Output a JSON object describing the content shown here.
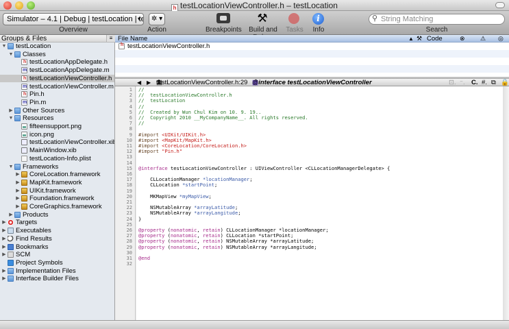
{
  "window": {
    "title": "testLocationViewController.h – testLocation"
  },
  "toolbar": {
    "overview_value": "Simulator – 4.1 | Debug | testLocation | tes…",
    "overview_label": "Overview",
    "action_label": "Action",
    "breakpoints_label": "Breakpoints",
    "build_debug_label": "Build and Debug",
    "tasks_label": "Tasks",
    "info_label": "Info",
    "search_placeholder": "String Matching",
    "search_label": "Search",
    "action_glyph": "✲ ▾",
    "info_glyph": "i",
    "hammer_glyph": "⚒"
  },
  "groups_header": "Groups & Files",
  "tree": [
    {
      "label": "testLocation",
      "icon": "project",
      "depth": 0,
      "expanded": true
    },
    {
      "label": "Classes",
      "icon": "folder",
      "depth": 1,
      "expanded": true
    },
    {
      "label": "testLocationAppDelegate.h",
      "icon": "h",
      "depth": 2
    },
    {
      "label": "testLocationAppDelegate.m",
      "icon": "m",
      "depth": 2
    },
    {
      "label": "testLocationViewController.h",
      "icon": "h",
      "depth": 2,
      "selected": true
    },
    {
      "label": "testLocationViewController.m",
      "icon": "m",
      "depth": 2
    },
    {
      "label": "Pin.h",
      "icon": "h",
      "depth": 2
    },
    {
      "label": "Pin.m",
      "icon": "m",
      "depth": 2
    },
    {
      "label": "Other Sources",
      "icon": "folder",
      "depth": 1,
      "expanded": false
    },
    {
      "label": "Resources",
      "icon": "folder",
      "depth": 1,
      "expanded": true
    },
    {
      "label": "fifteensupport.png",
      "icon": "img",
      "depth": 2
    },
    {
      "label": "icon.png",
      "icon": "img",
      "depth": 2
    },
    {
      "label": "testLocationViewController.xib",
      "icon": "xib",
      "depth": 2
    },
    {
      "label": "MainWindow.xib",
      "icon": "xib",
      "depth": 2
    },
    {
      "label": "testLocation-Info.plist",
      "icon": "plist",
      "depth": 2
    },
    {
      "label": "Frameworks",
      "icon": "folder",
      "depth": 1,
      "expanded": true
    },
    {
      "label": "CoreLocation.framework",
      "icon": "fw",
      "depth": 2,
      "expanded": false
    },
    {
      "label": "MapKit.framework",
      "icon": "fw",
      "depth": 2,
      "expanded": false
    },
    {
      "label": "UIKit.framework",
      "icon": "fw",
      "depth": 2,
      "expanded": false
    },
    {
      "label": "Foundation.framework",
      "icon": "fw",
      "depth": 2,
      "expanded": false
    },
    {
      "label": "CoreGraphics.framework",
      "icon": "fw",
      "depth": 2,
      "expanded": false
    },
    {
      "label": "Products",
      "icon": "folder",
      "depth": 1,
      "expanded": false
    },
    {
      "label": "Targets",
      "icon": "target",
      "depth": 0,
      "expanded": false
    },
    {
      "label": "Executables",
      "icon": "exe",
      "depth": 0,
      "expanded": false
    },
    {
      "label": "Find Results",
      "icon": "find",
      "depth": 0,
      "expanded": false
    },
    {
      "label": "Bookmarks",
      "icon": "bm",
      "depth": 0,
      "expanded": false
    },
    {
      "label": "SCM",
      "icon": "scm",
      "depth": 0,
      "expanded": false
    },
    {
      "label": "Project Symbols",
      "icon": "sym",
      "depth": 0
    },
    {
      "label": "Implementation Files",
      "icon": "folder",
      "depth": 0,
      "expanded": false
    },
    {
      "label": "Interface Builder Files",
      "icon": "folder",
      "depth": 0,
      "expanded": false
    }
  ],
  "file_list": {
    "columns": [
      "File Name",
      "Code"
    ],
    "rows": [
      "testLocationViewController.h"
    ]
  },
  "editor_nav": {
    "file": "testLocationViewController.h:29",
    "symbol": "@interface testLocationViewController"
  },
  "code_lines": [
    [
      [
        "c",
        "//"
      ]
    ],
    [
      [
        "c",
        "//  testLocationViewController.h"
      ]
    ],
    [
      [
        "c",
        "//  testLocation"
      ]
    ],
    [
      [
        "c",
        "//"
      ]
    ],
    [
      [
        "c",
        "//  Created by Wun Chul Kim on 10. 9. 19.."
      ]
    ],
    [
      [
        "c",
        "//  Copyright 2010 __MyCompanyName__. All rights reserved."
      ]
    ],
    [
      [
        "c",
        "//"
      ]
    ],
    [],
    [
      [
        "p",
        "#import "
      ],
      [
        "s",
        "<UIKit/UIKit.h>"
      ]
    ],
    [
      [
        "p",
        "#import "
      ],
      [
        "s",
        "<MapKit/MapKit.h>"
      ]
    ],
    [
      [
        "p",
        "#import "
      ],
      [
        "s",
        "<CoreLocation/CoreLocation.h>"
      ]
    ],
    [
      [
        "p",
        "#import "
      ],
      [
        "s",
        "\"Pin.h\""
      ]
    ],
    [],
    [],
    [
      [
        "k",
        "@interface"
      ],
      [
        "n",
        " testLocationViewController : UIViewController <CLLocationManagerDelegate> {"
      ]
    ],
    [],
    [
      [
        "n",
        "    CLLocationManager "
      ],
      [
        "v",
        "*locationManager"
      ],
      [
        "n",
        ";"
      ]
    ],
    [
      [
        "n",
        "    CLLocation "
      ],
      [
        "v",
        "*startPoint"
      ],
      [
        "n",
        ";"
      ]
    ],
    [],
    [
      [
        "n",
        "    MKMapView "
      ],
      [
        "v",
        "*myMapView"
      ],
      [
        "n",
        ";"
      ]
    ],
    [],
    [
      [
        "n",
        "    NSMutableArray "
      ],
      [
        "v",
        "*arrayLatitude"
      ],
      [
        "n",
        ";"
      ]
    ],
    [
      [
        "n",
        "    NSMutableArray "
      ],
      [
        "v",
        "*arrayLangitude"
      ],
      [
        "n",
        ";"
      ]
    ],
    [
      [
        "n",
        "}"
      ]
    ],
    [],
    [
      [
        "k",
        "@property"
      ],
      [
        "n",
        " ("
      ],
      [
        "k",
        "nonatomic"
      ],
      [
        "n",
        ", "
      ],
      [
        "k",
        "retain"
      ],
      [
        "n",
        ") CLLocationManager *locationManager;"
      ]
    ],
    [
      [
        "k",
        "@property"
      ],
      [
        "n",
        " ("
      ],
      [
        "k",
        "nonatomic"
      ],
      [
        "n",
        ", "
      ],
      [
        "k",
        "retain"
      ],
      [
        "n",
        ") CLLocation *startPoint;"
      ]
    ],
    [
      [
        "k",
        "@property"
      ],
      [
        "n",
        " ("
      ],
      [
        "k",
        "nonatomic"
      ],
      [
        "n",
        ", "
      ],
      [
        "k",
        "retain"
      ],
      [
        "n",
        ") NSMutableArray *arrayLatitude;"
      ]
    ],
    [
      [
        "k",
        "@property"
      ],
      [
        "n",
        " ("
      ],
      [
        "k",
        "nonatomic"
      ],
      [
        "n",
        ", "
      ],
      [
        "k",
        "retain"
      ],
      [
        "n",
        ") NSMutableArray *arrayLangitude;"
      ]
    ],
    [],
    [
      [
        "k",
        "@end"
      ]
    ],
    []
  ]
}
